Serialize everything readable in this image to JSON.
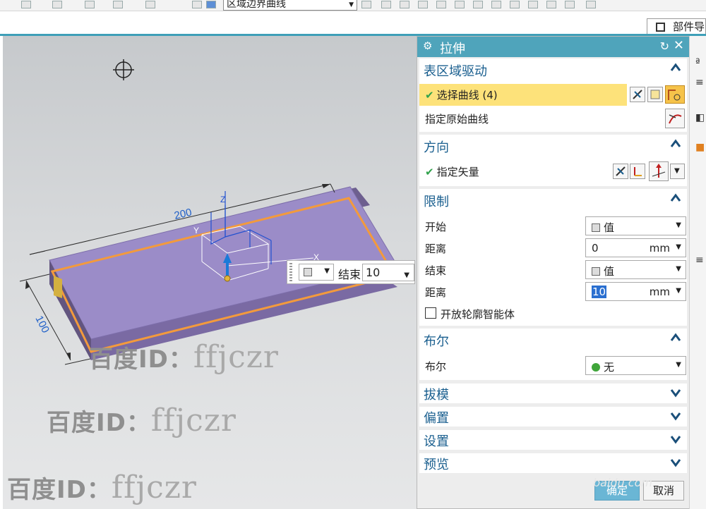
{
  "toolbar": {
    "curve_rule_value": "区域边界曲线"
  },
  "part_navigator": {
    "tab_label": "部件导"
  },
  "viewport": {
    "dimension_length": "200",
    "dimension_width": "100",
    "axis_x": "X",
    "axis_y": "Y",
    "axis_z": "Z",
    "screen_input": {
      "label": "结束",
      "value": "10"
    }
  },
  "dialog": {
    "title": "拉伸",
    "sections": {
      "section_curve": {
        "title": "表区域驱动",
        "select_curve": "选择曲线 (4)",
        "specify_origin_curve": "指定原始曲线"
      },
      "direction": {
        "title": "方向",
        "specify_vector": "指定矢量"
      },
      "limits": {
        "title": "限制",
        "start_label": "开始",
        "start_option": "值",
        "start_distance_label": "距离",
        "start_distance": "0",
        "start_unit": "mm",
        "end_label": "结束",
        "end_option": "值",
        "end_distance_label": "距离",
        "end_distance": "10",
        "end_unit": "mm",
        "open_profile": "开放轮廓智能体"
      },
      "boolean": {
        "title": "布尔",
        "label": "布尔",
        "option": "无"
      },
      "draft": {
        "title": "拔模"
      },
      "offset": {
        "title": "偏置"
      },
      "settings": {
        "title": "设置"
      },
      "preview": {
        "title": "预览"
      }
    },
    "ok_label": "确定",
    "cancel_label": "取消"
  },
  "watermarks": [
    {
      "a": "百度ID：",
      "b": "ffjczr"
    },
    {
      "a": "百度ID：",
      "b": "ffjczr"
    },
    {
      "a": "百度ID：",
      "b": "ffjczr"
    }
  ],
  "baidu_watermark": "baidu.com",
  "colors": {
    "title_bar": "#4fa4bb",
    "plate": "#9b8cc8",
    "outline": "#f39a3c",
    "section_title": "#1a5f8f",
    "highlight_row": "#fde27a"
  }
}
